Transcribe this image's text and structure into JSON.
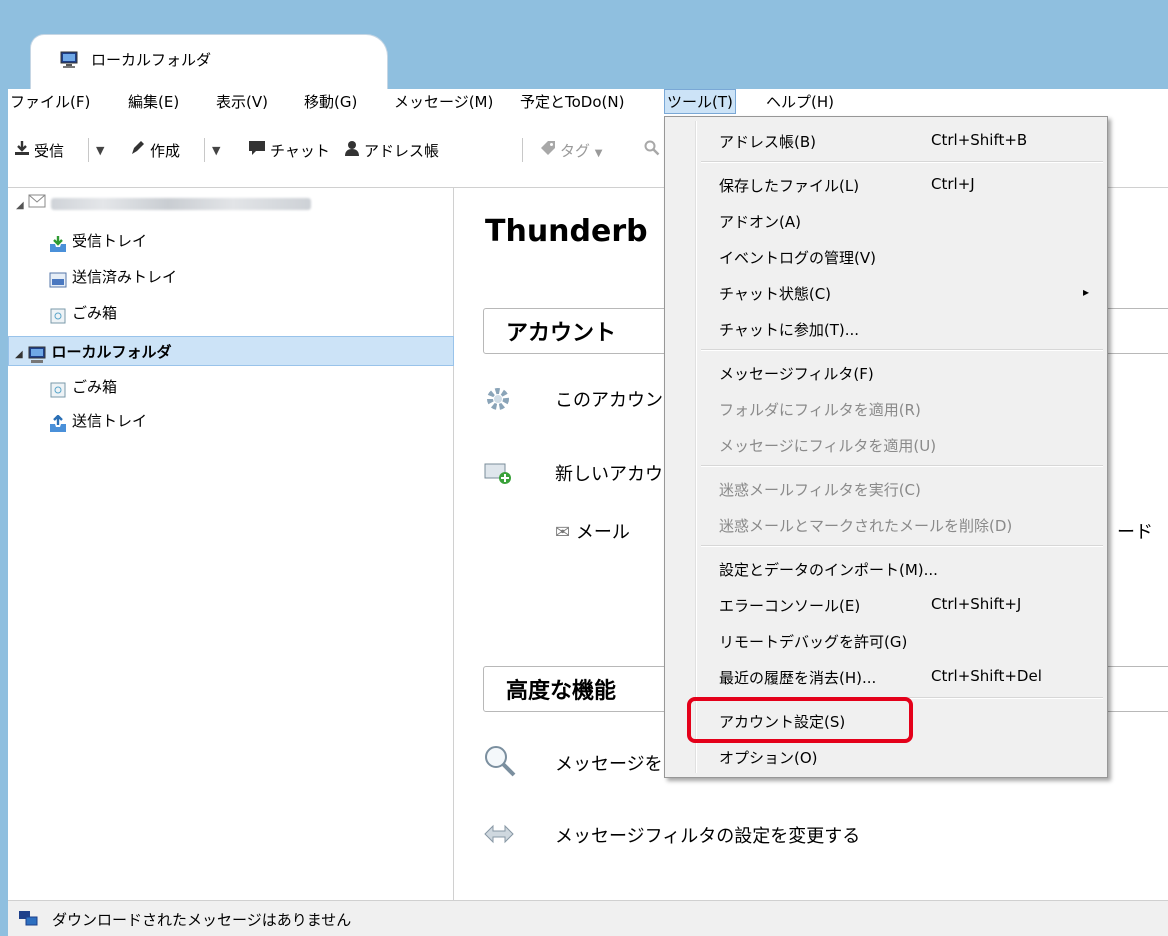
{
  "tab": {
    "label": "ローカルフォルダ"
  },
  "menubar": [
    {
      "label": "ファイル(F)"
    },
    {
      "label": "編集(E)"
    },
    {
      "label": "表示(V)"
    },
    {
      "label": "移動(G)"
    },
    {
      "label": "メッセージ(M)"
    },
    {
      "label": "予定とToDo(N)"
    },
    {
      "label": "ツール(T)"
    },
    {
      "label": "ヘルプ(H)"
    }
  ],
  "toolbar": {
    "get_mail": "受信",
    "write": "作成",
    "chat": "チャット",
    "address_book": "アドレス帳",
    "tag": "タグ"
  },
  "folders": {
    "inbox": "受信トレイ",
    "sent": "送信済みトレイ",
    "trash": "ごみ箱",
    "local_folders": "ローカルフォルダ",
    "local_trash": "ごみ箱",
    "outbox": "送信トレイ"
  },
  "content": {
    "title": "Thunderb",
    "accounts_header": "アカウント",
    "view_settings": "このアカウン",
    "new_account": "新しいアカウ",
    "mail": "メール",
    "trailing": "ード",
    "advanced_header": "高度な機能",
    "search_messages": "メッセージを",
    "manage_filters": "メッセージフィルタの設定を変更する"
  },
  "tools_menu": {
    "items": [
      {
        "label": "アドレス帳(B)",
        "shortcut": "Ctrl+Shift+B"
      },
      {
        "label": "保存したファイル(L)",
        "shortcut": "Ctrl+J"
      },
      {
        "label": "アドオン(A)",
        "shortcut": ""
      },
      {
        "label": "イベントログの管理(V)",
        "shortcut": ""
      },
      {
        "label": "チャット状態(C)",
        "shortcut": ""
      },
      {
        "label": "チャットに参加(T)...",
        "shortcut": ""
      },
      {
        "label": "メッセージフィルタ(F)",
        "shortcut": ""
      },
      {
        "label": "フォルダにフィルタを適用(R)",
        "shortcut": ""
      },
      {
        "label": "メッセージにフィルタを適用(U)",
        "shortcut": ""
      },
      {
        "label": "迷惑メールフィルタを実行(C)",
        "shortcut": ""
      },
      {
        "label": "迷惑メールとマークされたメールを削除(D)",
        "shortcut": ""
      },
      {
        "label": "設定とデータのインポート(M)...",
        "shortcut": ""
      },
      {
        "label": "エラーコンソール(E)",
        "shortcut": "Ctrl+Shift+J"
      },
      {
        "label": "リモートデバッグを許可(G)",
        "shortcut": ""
      },
      {
        "label": "最近の履歴を消去(H)...",
        "shortcut": "Ctrl+Shift+Del"
      },
      {
        "label": "アカウント設定(S)",
        "shortcut": ""
      },
      {
        "label": "オプション(O)",
        "shortcut": ""
      }
    ],
    "submenu_arrow": "▸"
  },
  "status": {
    "text": "ダウンロードされたメッセージはありません"
  },
  "colors": {
    "titlebar": "#8fbfdf",
    "highlight_box": "#e4001a",
    "selection": "#cce3f7"
  }
}
